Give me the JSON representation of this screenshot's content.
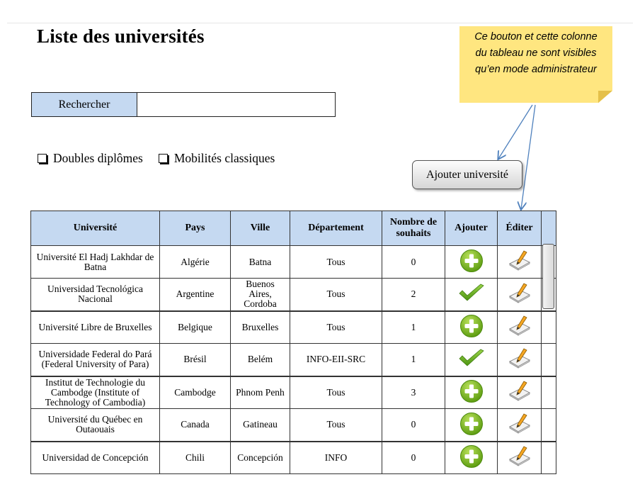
{
  "page": {
    "title": "Liste des universités"
  },
  "search": {
    "label": "Rechercher",
    "value": "",
    "placeholder": ""
  },
  "filters": [
    {
      "label": "Doubles diplômes",
      "checked": false
    },
    {
      "label": "Mobilités classiques",
      "checked": false
    }
  ],
  "add_button": {
    "label": "Ajouter université"
  },
  "note": {
    "lines": [
      "Ce bouton et cette colonne",
      "du tableau ne sont visibles",
      "qu’en mode administrateur"
    ]
  },
  "table": {
    "headers": {
      "universite": "Université",
      "pays": "Pays",
      "ville": "Ville",
      "departement": "Département",
      "souhaits": "Nombre de souhaits",
      "ajouter": "Ajouter",
      "editer": "Éditer"
    },
    "rows": [
      {
        "universite": "Université El Hadj Lakhdar de Batna",
        "pays": "Algérie",
        "ville": "Batna",
        "departement": "Tous",
        "souhaits": "0",
        "ajouter": "plus-icon"
      },
      {
        "universite": "Universidad Tecnológica Nacional",
        "pays": "Argentine",
        "ville": "Buenos Aires, Cordoba",
        "departement": "Tous",
        "souhaits": "2",
        "ajouter": "check-icon"
      },
      {
        "universite": "Université Libre de Bruxelles",
        "pays": "Belgique",
        "ville": "Bruxelles",
        "departement": "Tous",
        "souhaits": "1",
        "ajouter": "plus-icon"
      },
      {
        "universite": "Universidade Federal do Pará (Federal University of Para)",
        "pays": "Brésil",
        "ville": "Belém",
        "departement": "INFO-EII-SRC",
        "souhaits": "1",
        "ajouter": "check-icon"
      },
      {
        "universite": "Institut de Technologie du Cambodge (Institute of Technology of Cambodia)",
        "pays": "Cambodge",
        "ville": "Phnom Penh",
        "departement": "Tous",
        "souhaits": "3",
        "ajouter": "plus-icon"
      },
      {
        "universite": "Université du Québec en Outaouais",
        "pays": "Canada",
        "ville": "Gatineau",
        "departement": "Tous",
        "souhaits": "0",
        "ajouter": "plus-icon"
      },
      {
        "universite": "Universidad de Concepción",
        "pays": "Chili",
        "ville": "Concepción",
        "departement": "INFO",
        "souhaits": "0",
        "ajouter": "plus-icon"
      }
    ]
  },
  "colors": {
    "header_bg": "#c5d9f1",
    "note_bg": "#ffe680",
    "plus_green": "#7dbb1f",
    "check_green": "#5aa820",
    "arrow": "#4f81bd"
  }
}
